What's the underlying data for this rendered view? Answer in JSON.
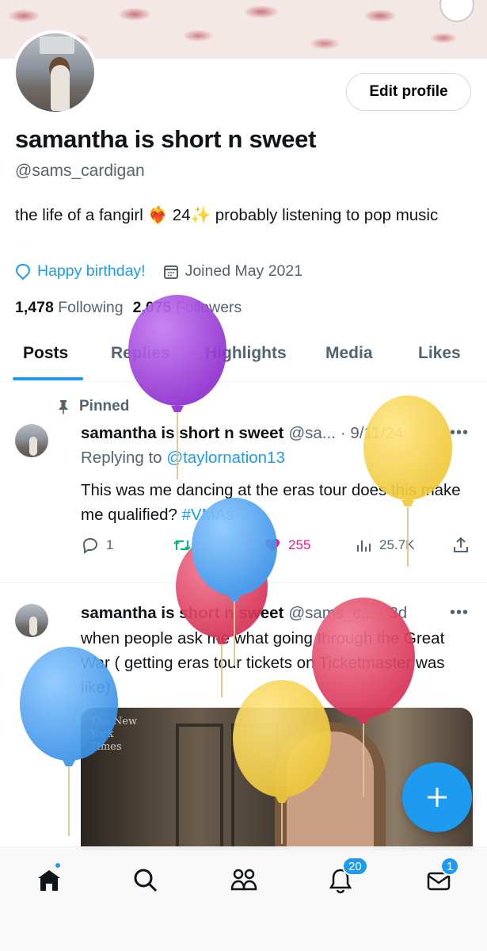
{
  "profile": {
    "name": "samantha is short n sweet",
    "handle": "@sams_cardigan",
    "bio": "the life of a fangirl ❤️‍🔥 24✨ probably listening to pop music",
    "birthday": "Happy birthday!",
    "joined": "Joined May 2021",
    "following_count": "1,478",
    "following_label": "Following",
    "followers_count": "2,075",
    "followers_label": "Followers",
    "edit_label": "Edit profile"
  },
  "tabs": [
    "Posts",
    "Replies",
    "Highlights",
    "Media",
    "Likes"
  ],
  "posts": [
    {
      "pinned_label": "Pinned",
      "name": "samantha is short n sweet",
      "handle": "@sa...",
      "date": "· 9/11/24",
      "reply_prefix": "Replying to",
      "reply_to": "@taylornation13",
      "text": "This was me dancing at the eras tour does this make me qualified?",
      "hashtag": "#VMAs",
      "replies": "1",
      "likes": "255",
      "views": "25.7K"
    },
    {
      "name": "samantha is short n sweet",
      "handle": "@sams_c...",
      "date": "· 3d",
      "text": "when people ask me what going through the Great War ( getting eras tour tickets on Ticketmaster was like)",
      "media_caption": "The New York Times"
    }
  ],
  "nav": {
    "notifications_badge": "20",
    "messages_badge": "1"
  },
  "icons": [
    "location-icon",
    "calendar-icon",
    "pin-icon",
    "reply-icon",
    "retweet-icon",
    "heart-icon",
    "views-icon",
    "share-icon",
    "more-icon",
    "plus-icon",
    "home-icon",
    "search-icon",
    "communities-icon",
    "bell-icon",
    "mail-icon"
  ],
  "colors": {
    "accent": "#1d9bf0",
    "like": "#f91880",
    "retweet": "#00ba7c"
  }
}
